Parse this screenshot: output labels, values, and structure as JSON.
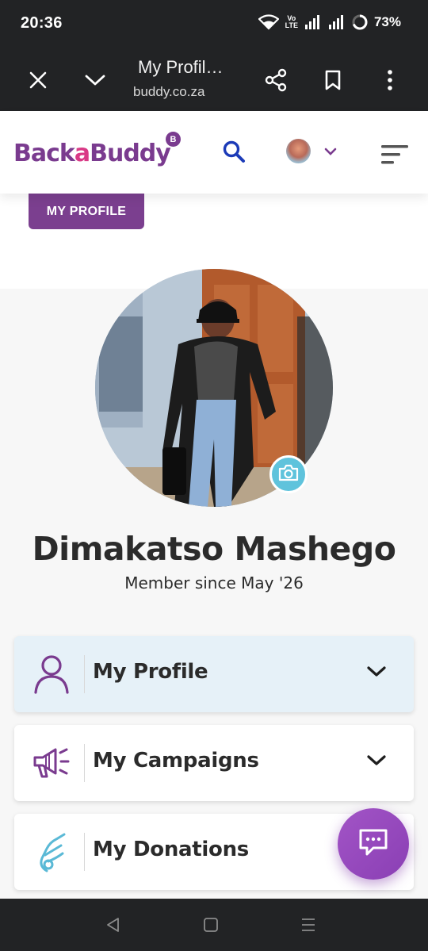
{
  "status_bar": {
    "time": "20:36",
    "volte_top": "Vo",
    "volte_bottom": "LTE",
    "battery": "73%"
  },
  "browser": {
    "title": "My Profil…",
    "url": "buddy.co.za",
    "icons": [
      "close-icon",
      "chevron-down-icon",
      "share-icon",
      "bookmark-icon",
      "more-vert-icon"
    ]
  },
  "site_header": {
    "logo_part1": "Back",
    "logo_part2": "a",
    "logo_part3": "Buddy",
    "logo_badge": "B",
    "colors": {
      "brand_purple": "#7a3b8f",
      "brand_pink": "#d93a86",
      "search_blue": "#1c3bb8"
    }
  },
  "page": {
    "tag": "MY PROFILE",
    "user_name": "Dimakatso Mashego",
    "member_since": "Member since May '26"
  },
  "cards": [
    {
      "label": "My Profile",
      "icon": "user-icon",
      "active": true
    },
    {
      "label": "My Campaigns",
      "icon": "megaphone-icon",
      "active": false
    },
    {
      "label": "My Donations",
      "icon": "hand-heart-icon",
      "active": false
    }
  ],
  "chat": {
    "icon": "chat-icon",
    "color": "#9a4cc2"
  },
  "nav": {
    "icons": [
      "back-icon",
      "home-icon",
      "recents-icon"
    ]
  }
}
